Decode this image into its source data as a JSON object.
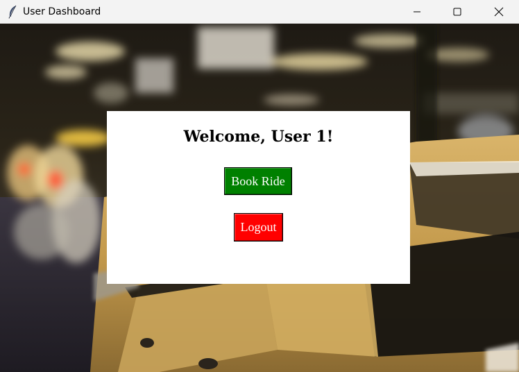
{
  "window": {
    "title": "User Dashboard",
    "icon": "feather-icon",
    "controls": {
      "minimize_icon": "minimize-icon",
      "maximize_icon": "maximize-icon",
      "close_icon": "close-icon"
    }
  },
  "background": {
    "description_icon": "taxi-queue-photo"
  },
  "card": {
    "welcome_text": "Welcome, User 1!",
    "book_ride_label": "Book Ride",
    "logout_label": "Logout"
  },
  "colors": {
    "book_ride_bg": "#008000",
    "logout_bg": "#ff0000",
    "card_bg": "#ffffff",
    "titlebar_bg": "#f3f3f3"
  }
}
